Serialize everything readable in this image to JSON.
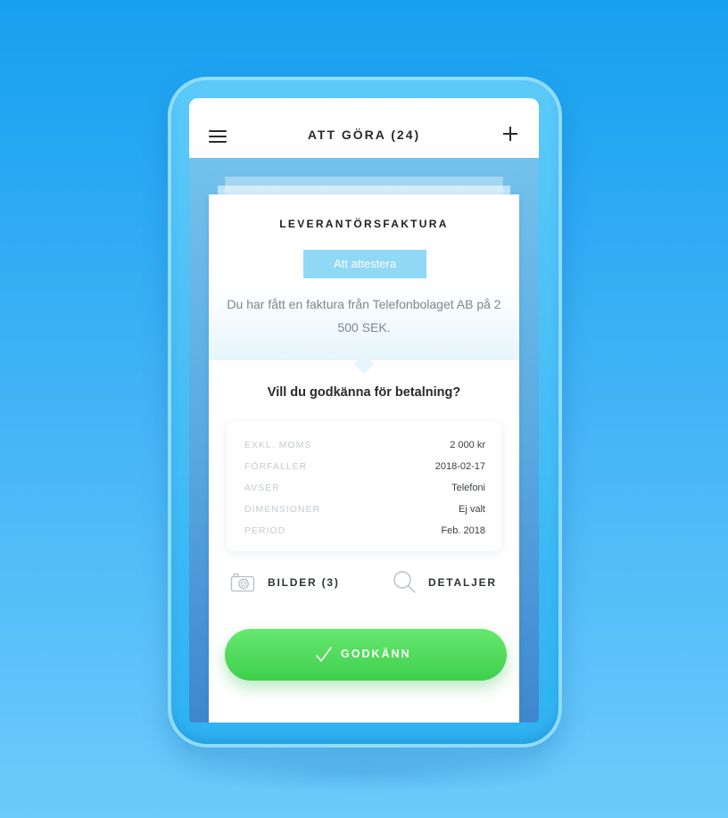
{
  "header": {
    "title": "ATT GÖRA (24)",
    "menu_icon": "hamburger-menu-icon",
    "add_icon": "plus-icon"
  },
  "card": {
    "title": "LEVERANTÖRSFAKTURA",
    "status_badge": "Att attestera",
    "description": "Du har fått en faktura från Telefonbolaget AB på 2 500 SEK.",
    "question": "Vill du godkänna för betalning?",
    "details": [
      {
        "label": "EXKL. MOMS",
        "value": "2 000 kr"
      },
      {
        "label": "FÖRFALLER",
        "value": "2018-02-17"
      },
      {
        "label": "AVSER",
        "value": "Telefoni"
      },
      {
        "label": "DIMENSIONER",
        "value": "Ej valt"
      },
      {
        "label": "PERIOD",
        "value": "Feb. 2018"
      }
    ],
    "images_label": "BILDER (3)",
    "images_icon": "camera-icon",
    "details_label": "DETALJER",
    "details_icon": "magnifier-icon",
    "approve_label": "GODKÄNN",
    "approve_icon": "checkmark-icon"
  },
  "colors": {
    "background": "#1ea6f2",
    "approve_green": "#4cd757",
    "badge_blue": "#8fd8f6"
  }
}
